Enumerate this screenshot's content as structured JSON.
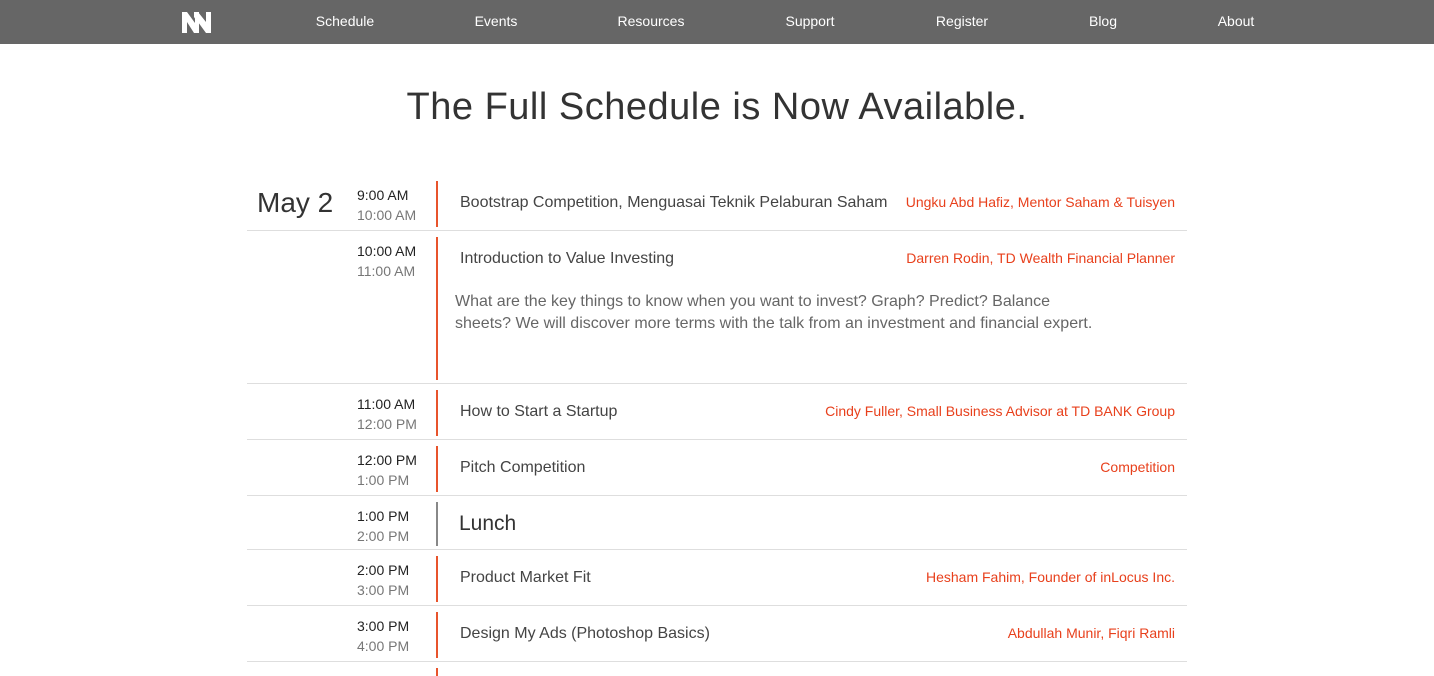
{
  "nav": {
    "logo_icon": "nn-logo-icon",
    "items": [
      {
        "label": "Schedule"
      },
      {
        "label": "Events"
      },
      {
        "label": "Resources"
      },
      {
        "label": "Support"
      },
      {
        "label": "Register"
      },
      {
        "label": "Blog"
      },
      {
        "label": "About"
      }
    ]
  },
  "page_title": "The Full Schedule is Now Available.",
  "schedule": {
    "day_label": "May 2",
    "sessions": [
      {
        "start": "9:00 AM",
        "end": "10:00 AM",
        "title": "Bootstrap Competition, Menguasai Teknik Pelaburan Saham",
        "speaker": "Ungku Abd Hafiz, Mentor Saham & Tuisyen"
      },
      {
        "start": "10:00 AM",
        "end": "11:00 AM",
        "title": "Introduction to Value Investing",
        "speaker": "Darren Rodin, TD Wealth Financial Planner",
        "description": "What are the key things to know when you want to invest? Graph? Predict? Balance sheets? We will discover more terms with the talk from an investment and financial expert."
      },
      {
        "start": "11:00 AM",
        "end": "12:00 PM",
        "title": "How to Start a Startup",
        "speaker": "Cindy Fuller, Small Business Advisor at TD BANK Group"
      },
      {
        "start": "12:00 PM",
        "end": "1:00 PM",
        "title": "Pitch Competition",
        "speaker": "Competition"
      },
      {
        "start": "1:00 PM",
        "end": "2:00 PM",
        "title": "Lunch"
      },
      {
        "start": "2:00 PM",
        "end": "3:00 PM",
        "title": "Product Market Fit",
        "speaker": "Hesham Fahim, Founder of inLocus Inc."
      },
      {
        "start": "3:00 PM",
        "end": "4:00 PM",
        "title": "Design My Ads (Photoshop Basics)",
        "speaker": "Abdullah Munir, Fiqri Ramli"
      }
    ]
  },
  "colors": {
    "nav_bg": "#666666",
    "accent": "#e8401c",
    "divider": "#dedede"
  }
}
